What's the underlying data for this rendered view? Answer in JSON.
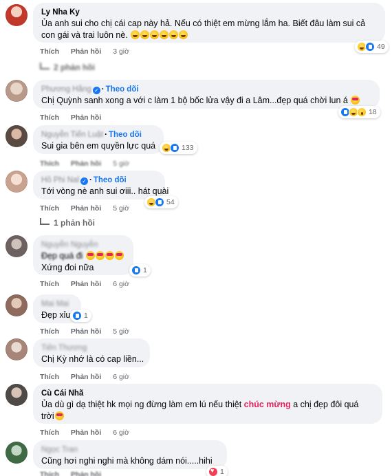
{
  "labels": {
    "like": "Thích",
    "reply": "Phản hồi",
    "follow": "Theo dõi"
  },
  "comments": [
    {
      "name": "Ly Nha Ky",
      "lines": [
        "Ủa anh sui cho chị cái cap này hả. Nếu có thiệt em mừng lắm ha. Biết đâu làm sui cả",
        "con gái và trai luôn nè."
      ],
      "time": "3 giờ",
      "reaction_count": "49",
      "reaction_icons": [
        "haha",
        "like"
      ],
      "replies": "2 phản hồi"
    },
    {
      "name": "Phương Hằng",
      "lines": [
        "Chị Quỳnh sanh xong a với c làm 1 bộ bốc lửa vậy đi a Lâm...đẹp quá chời lun á"
      ],
      "time": "",
      "reaction_count": "18",
      "reaction_icons": [
        "like",
        "haha",
        "wow"
      ]
    },
    {
      "name": "Nguyễn Tiến Luật",
      "lines": [
        "Sui gia bên em quyền lực quá"
      ],
      "time": "5 giờ",
      "reaction_count": "133",
      "reaction_icons": [
        "haha",
        "like"
      ]
    },
    {
      "name": "Hồ Phi Nal",
      "lines": [
        "Tới vòng nè anh sui ơiii.. hát quài"
      ],
      "time": "5 giờ",
      "reaction_count": "54",
      "reaction_icons": [
        "haha",
        "like"
      ],
      "replies": "1 phản hồi"
    },
    {
      "name": "Nguyễn Nguyễn",
      "lines": [
        "Đẹp quá đi",
        "Xứng đoi nữa"
      ],
      "time": "6 giờ",
      "reaction_count": "1",
      "reaction_icons": [
        "like"
      ]
    },
    {
      "name": "Mai Mai",
      "lines": [
        "Đẹp xỉu"
      ],
      "time": "5 giờ",
      "reaction_count": "1",
      "reaction_icons": [
        "like"
      ]
    },
    {
      "name": "Tiến Thương",
      "lines": [
        "Chị Kỳ nhớ là có cap liền..."
      ],
      "time": "6 giờ"
    },
    {
      "name": "Cù Cái Nhã",
      "lines_rich": [
        {
          "before": "Ủa dù gì dạ thiệt hk mọi ng đừng làm em lú nếu thiệt ",
          "highlight": "chúc mừng",
          "after": " a chị đẹp đôi quá"
        },
        {
          "before": "trời",
          "highlight": "",
          "after": ""
        }
      ],
      "time": "6 giờ"
    },
    {
      "name": "Ngọc Tran",
      "lines": [
        "Cũng hơi nghi nghi mà không dám nói.....hihi"
      ],
      "time": "",
      "reaction_count": "1",
      "reaction_icons": [
        "love"
      ]
    }
  ],
  "colors": {
    "link_blue": "#1877f2",
    "bubble_bg": "#f0f2f5",
    "highlight_pink": "#e0245e",
    "meta_gray": "#65676b"
  }
}
